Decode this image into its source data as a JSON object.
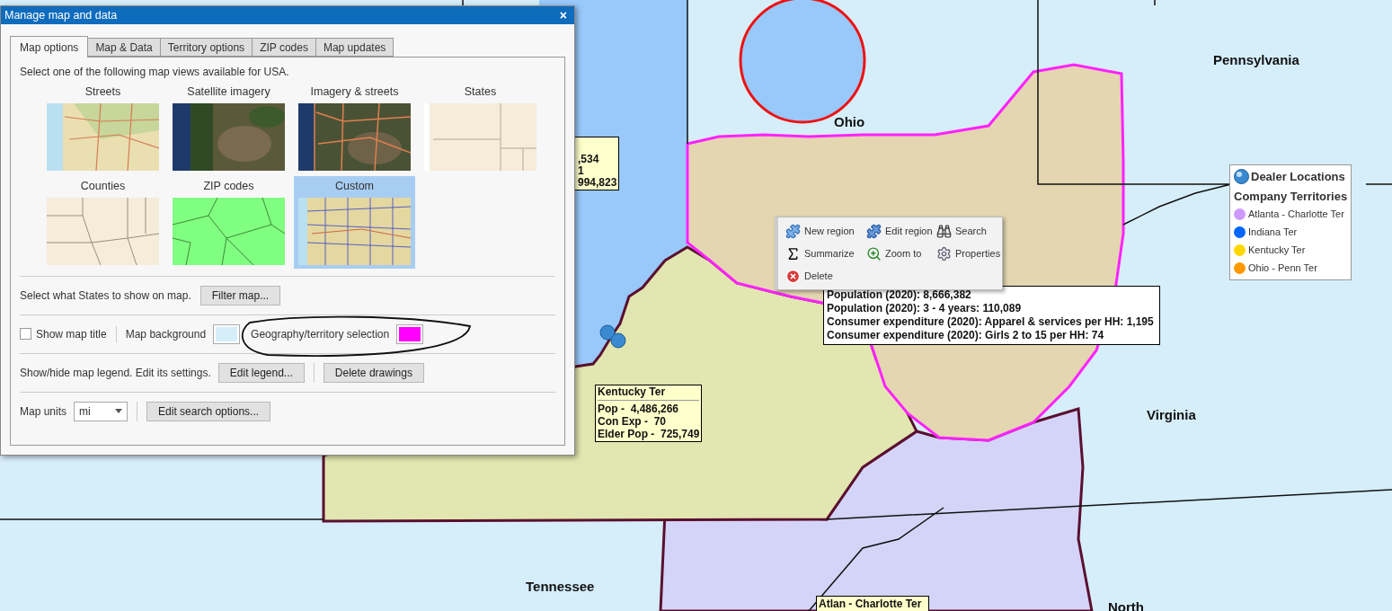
{
  "dialog": {
    "title": "Manage map and data",
    "close": "×",
    "tabs": [
      {
        "label": "Map options",
        "selected": true
      },
      {
        "label": "Map & Data",
        "selected": false
      },
      {
        "label": "Territory options",
        "selected": false
      },
      {
        "label": "ZIP codes",
        "selected": false
      },
      {
        "label": "Map updates",
        "selected": false
      }
    ],
    "intro": "Select one of the following map views available for USA.",
    "map_views": [
      {
        "label": "Streets",
        "kind": "streets",
        "selected": false
      },
      {
        "label": "Satellite imagery",
        "kind": "satellite",
        "selected": false
      },
      {
        "label": "Imagery & streets",
        "kind": "hybrid",
        "selected": false
      },
      {
        "label": "States",
        "kind": "states",
        "selected": false
      },
      {
        "label": "Counties",
        "kind": "counties",
        "selected": false
      },
      {
        "label": "ZIP codes",
        "kind": "zip",
        "selected": false
      },
      {
        "label": "Custom",
        "kind": "custom",
        "selected": true
      }
    ],
    "filter": {
      "label": "Select what States to show on map.",
      "button": "Filter map..."
    },
    "show_map_title": {
      "label": "Show map title",
      "checked": false
    },
    "map_background": {
      "label": "Map background",
      "color": "#d6eefa"
    },
    "selection_color": {
      "label": "Geography/territory selection",
      "color": "#ff00ff"
    },
    "legend_row": {
      "label": "Show/hide map legend. Edit its settings.",
      "buttons": [
        "Edit legend...",
        "Delete drawings"
      ]
    },
    "map_units": {
      "label": "Map units",
      "value": "mi",
      "button": "Edit search options..."
    }
  },
  "map": {
    "state_labels": [
      "Ohio",
      "Pennsylvania",
      "Virginia",
      "Tennessee",
      "North"
    ],
    "partial_info_box": {
      "lines": [
        ",534",
        "1",
        "994,823"
      ]
    },
    "kentucky_box": {
      "title": "Kentucky Ter",
      "lines": [
        "Pop -  4,486,266",
        "Con Exp -  70",
        "Elder Pop -  725,749"
      ]
    },
    "atlanta_box": {
      "title": "Atlan - Charlotte Ter"
    },
    "context_menu": {
      "items": [
        {
          "label": "New region",
          "kind": "new"
        },
        {
          "label": "Edit region",
          "kind": "edit"
        },
        {
          "label": "Search",
          "kind": "search"
        },
        {
          "label": "Summarize",
          "kind": "summarize"
        },
        {
          "label": "Zoom to",
          "kind": "zoom"
        },
        {
          "label": "Properties",
          "kind": "properties"
        },
        {
          "label": "Delete",
          "kind": "delete"
        }
      ]
    },
    "info_popup": {
      "lines": [
        "Population (2020): 8,666,382",
        "Population (2020): 3 - 4 years: 110,089",
        "Consumer expenditure (2020): Apparel & services per HH: 1,195",
        "Consumer expenditure (2020): Girls 2 to 15 per HH: 74"
      ]
    },
    "legend": {
      "title": "Dealer Locations",
      "subtitle": "Company Territories",
      "items": [
        {
          "label": "Atlanta - Charlotte Ter",
          "color": "#cc99ff"
        },
        {
          "label": "Indiana Ter",
          "color": "#0066ff"
        },
        {
          "label": "Kentucky Ter",
          "color": "#ffd700"
        },
        {
          "label": "Ohio - Penn Ter",
          "color": "#ff9900"
        }
      ]
    }
  }
}
